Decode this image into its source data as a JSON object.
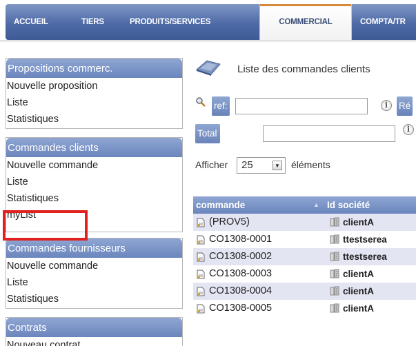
{
  "topnav": {
    "tabs": [
      {
        "label": "ACCUEIL"
      },
      {
        "label": "TIERS"
      },
      {
        "label": "PRODUITS/SERVICES"
      },
      {
        "label": "COMMERCIAL"
      },
      {
        "label": "COMPTA/TR"
      }
    ],
    "active_tab": "COMMERCIAL"
  },
  "sidebar": {
    "sections": [
      {
        "title": "Propositions commerc.",
        "items": [
          "Nouvelle proposition",
          "Liste",
          "Statistiques"
        ]
      },
      {
        "title": "Commandes clients",
        "items": [
          "Nouvelle commande",
          "Liste",
          "Statistiques",
          "myList"
        ]
      },
      {
        "title": "Commandes fournisseurs",
        "items": [
          "Nouvelle commande",
          "Liste",
          "Statistiques"
        ]
      },
      {
        "title": "Contrats",
        "items": [
          "Nouveau contrat"
        ]
      }
    ],
    "highlighted_item": "myList"
  },
  "main": {
    "page_title": "Liste des commandes clients",
    "filters": {
      "ref_label": "ref:",
      "ref_value": "",
      "ref_extra": "Ré",
      "total_label": "Total TTC:",
      "total_value": ""
    },
    "length": {
      "before": "Afficher",
      "value": "25",
      "after": "éléments"
    },
    "table": {
      "headers": [
        "commande",
        "Id société"
      ],
      "rows": [
        {
          "ref": "(PROV5)",
          "client": "clientA"
        },
        {
          "ref": "CO1308-0001",
          "client": "ttestserea"
        },
        {
          "ref": "CO1308-0002",
          "client": "ttestserea"
        },
        {
          "ref": "CO1308-0003",
          "client": "clientA"
        },
        {
          "ref": "CO1308-0004",
          "client": "clientA"
        },
        {
          "ref": "CO1308-0005",
          "client": "clientA"
        }
      ]
    }
  },
  "colors": {
    "nav_blue": "#4e6aa6",
    "header_blue": "#6b86bd",
    "row_alt": "#e3e5f3",
    "highlight_red": "#e32020",
    "active_tab_accent": "#d58a3c"
  }
}
